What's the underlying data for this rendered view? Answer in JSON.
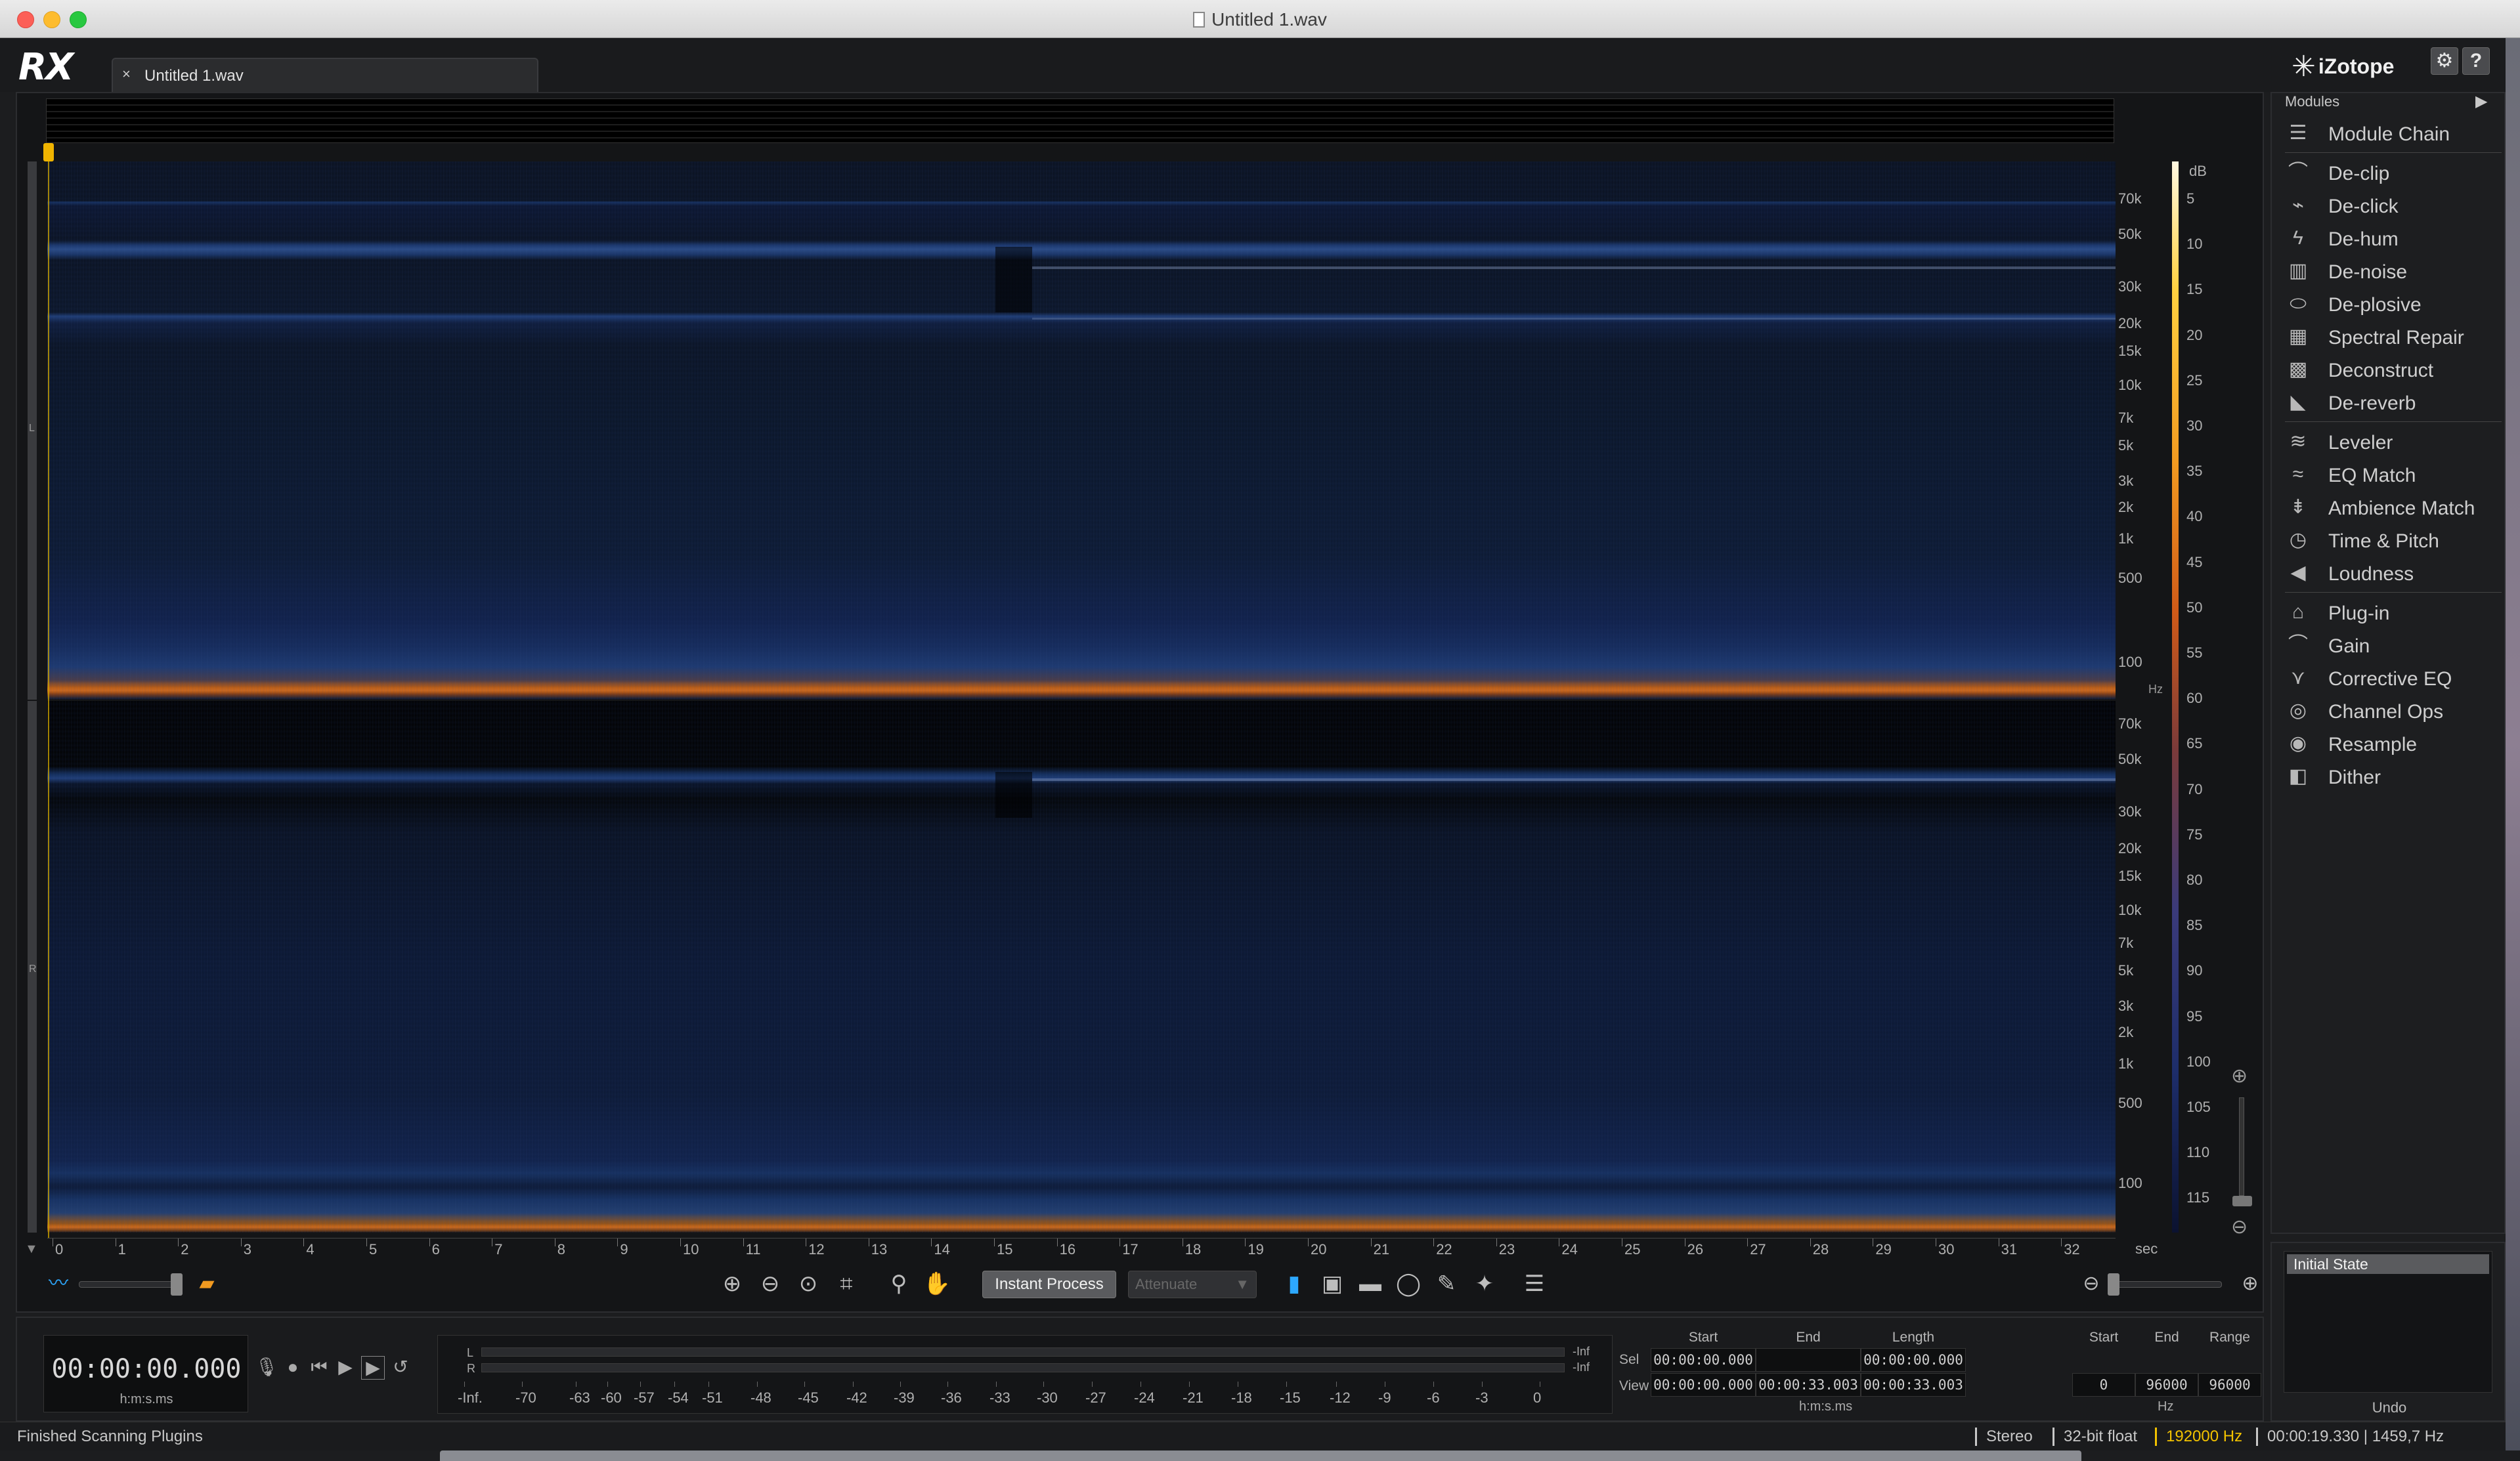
{
  "window": {
    "title": "Untitled 1.wav"
  },
  "app": {
    "logo": "RX",
    "brand": "iZotope",
    "tab": {
      "label": "Untitled 1.wav",
      "close": "×"
    },
    "help": "?"
  },
  "editor": {
    "channels": [
      "L",
      "R"
    ],
    "freq_ticks": [
      "70k",
      "50k",
      "30k",
      "20k",
      "15k",
      "10k",
      "7k",
      "5k",
      "3k",
      "2k",
      "1k",
      "500",
      "100"
    ],
    "freq_unit": "Hz",
    "db_unit": "dB",
    "db_ticks": [
      "5",
      "10",
      "15",
      "20",
      "25",
      "30",
      "35",
      "40",
      "45",
      "50",
      "55",
      "60",
      "65",
      "70",
      "75",
      "80",
      "85",
      "90",
      "95",
      "100",
      "105",
      "110",
      "115"
    ],
    "time_ticks": [
      "0",
      "1",
      "2",
      "3",
      "4",
      "5",
      "6",
      "7",
      "8",
      "9",
      "10",
      "11",
      "12",
      "13",
      "14",
      "15",
      "16",
      "17",
      "18",
      "19",
      "20",
      "21",
      "22",
      "23",
      "24",
      "25",
      "26",
      "27",
      "28",
      "29",
      "30",
      "31",
      "32"
    ],
    "time_unit": "sec"
  },
  "toolbar": {
    "instant_process": "Instant Process",
    "attenuate": "Attenuate"
  },
  "transport": {
    "time_value": "00:00:00.000",
    "time_format": "h:m:s.ms"
  },
  "meter": {
    "labels": [
      "L",
      "R"
    ],
    "inf_l": "-Inf",
    "inf_r": "-Inf",
    "ticks": [
      "-Inf.",
      "-70",
      "-63",
      "-60",
      "-57",
      "-54",
      "-51",
      "-48",
      "-45",
      "-42",
      "-39",
      "-36",
      "-33",
      "-30",
      "-27",
      "-24",
      "-21",
      "-18",
      "-15",
      "-12",
      "-9",
      "-6",
      "-3",
      "0"
    ]
  },
  "selection": {
    "headers": {
      "start": "Start",
      "end": "End",
      "length": "Length"
    },
    "sel_label": "Sel",
    "view_label": "View",
    "sel": {
      "start": "00:00:00.000",
      "end": "",
      "length": "00:00:00.000"
    },
    "view": {
      "start": "00:00:00.000",
      "end": "00:00:33.003",
      "length": "00:00:33.003"
    },
    "unit": "h:m:s.ms"
  },
  "frequency": {
    "headers": {
      "start": "Start",
      "end": "End",
      "range": "Range"
    },
    "values": {
      "start": "0",
      "end": "96000",
      "range": "96000"
    },
    "unit": "Hz"
  },
  "modules": {
    "title": "Modules",
    "groups": [
      [
        {
          "label": "Module Chain",
          "icon": "module-chain-icon"
        }
      ],
      [
        {
          "label": "De-clip",
          "icon": "de-clip-icon"
        },
        {
          "label": "De-click",
          "icon": "de-click-icon"
        },
        {
          "label": "De-hum",
          "icon": "de-hum-icon"
        },
        {
          "label": "De-noise",
          "icon": "de-noise-icon"
        },
        {
          "label": "De-plosive",
          "icon": "de-plosive-icon"
        },
        {
          "label": "Spectral Repair",
          "icon": "spectral-repair-icon"
        },
        {
          "label": "Deconstruct",
          "icon": "deconstruct-icon"
        },
        {
          "label": "De-reverb",
          "icon": "de-reverb-icon"
        }
      ],
      [
        {
          "label": "Leveler",
          "icon": "leveler-icon"
        },
        {
          "label": "EQ Match",
          "icon": "eq-match-icon"
        },
        {
          "label": "Ambience Match",
          "icon": "ambience-match-icon"
        },
        {
          "label": "Time & Pitch",
          "icon": "time-pitch-icon"
        },
        {
          "label": "Loudness",
          "icon": "loudness-icon"
        }
      ],
      [
        {
          "label": "Plug-in",
          "icon": "plug-in-icon"
        },
        {
          "label": "Gain",
          "icon": "gain-icon"
        },
        {
          "label": "Corrective EQ",
          "icon": "corrective-eq-icon"
        },
        {
          "label": "Channel Ops",
          "icon": "channel-ops-icon"
        },
        {
          "label": "Resample",
          "icon": "resample-icon"
        },
        {
          "label": "Dither",
          "icon": "dither-icon"
        }
      ]
    ]
  },
  "undo": {
    "title": "Undo",
    "items": [
      "Initial State"
    ]
  },
  "status": {
    "message": "Finished Scanning Plugins",
    "channels": "Stereo",
    "bit_depth": "32-bit float",
    "sample_rate": "192000 Hz",
    "cursor": "00:00:19.330 | 1459,7 Hz",
    "rate_color": "#f2c200"
  }
}
